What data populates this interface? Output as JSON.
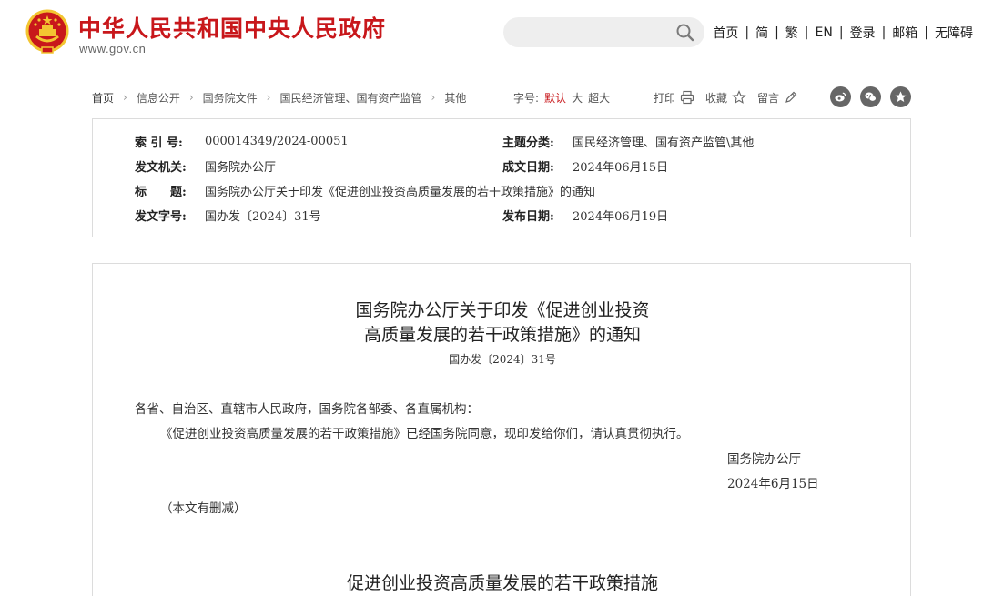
{
  "header": {
    "title": "中华人民共和国中央人民政府",
    "domain": "www.gov.cn",
    "search": {
      "value": "",
      "placeholder": ""
    },
    "nav": [
      "首页",
      "简",
      "繁",
      "EN",
      "登录",
      "邮箱",
      "无障碍"
    ]
  },
  "breadcrumb": [
    "首页",
    "信息公开",
    "国务院文件",
    "国民经济管理、国有资产监管",
    "其他"
  ],
  "font_size": {
    "label": "字号:",
    "options": [
      "默认",
      "大",
      "超大"
    ],
    "selected": "默认"
  },
  "tools": {
    "print": "打印",
    "favorite": "收藏",
    "comment": "留言"
  },
  "meta": {
    "index_label": "索 引 号:",
    "index_value": "000014349/2024-00051",
    "topic_label": "主题分类:",
    "topic_value": "国民经济管理、国有资产监管\\其他",
    "issuer_label": "发文机关:",
    "issuer_value": "国务院办公厅",
    "date_written_label": "成文日期:",
    "date_written_value": "2024年06月15日",
    "title_label": "标　　题:",
    "title_value": "国务院办公厅关于印发《促进创业投资高质量发展的若干政策措施》的通知",
    "doc_no_label": "发文字号:",
    "doc_no_value": "国办发〔2024〕31号",
    "publish_label": "发布日期:",
    "publish_value": "2024年06月19日"
  },
  "article": {
    "title_line1": "国务院办公厅关于印发《促进创业投资",
    "title_line2": "高质量发展的若干政策措施》的通知",
    "doc_no": "国办发〔2024〕31号",
    "salutation": "各省、自治区、直辖市人民政府，国务院各部委、各直属机构：",
    "body": "《促进创业投资高质量发展的若干政策措施》已经国务院同意，现印发给你们，请认真贯彻执行。",
    "signer": "国务院办公厅",
    "date": "2024年6月15日",
    "note": "（本文有删减）",
    "section_title": "促进创业投资高质量发展的若干政策措施"
  },
  "colors": {
    "brand_red": "#c8171b",
    "emblem_gold": "#f3c531"
  }
}
